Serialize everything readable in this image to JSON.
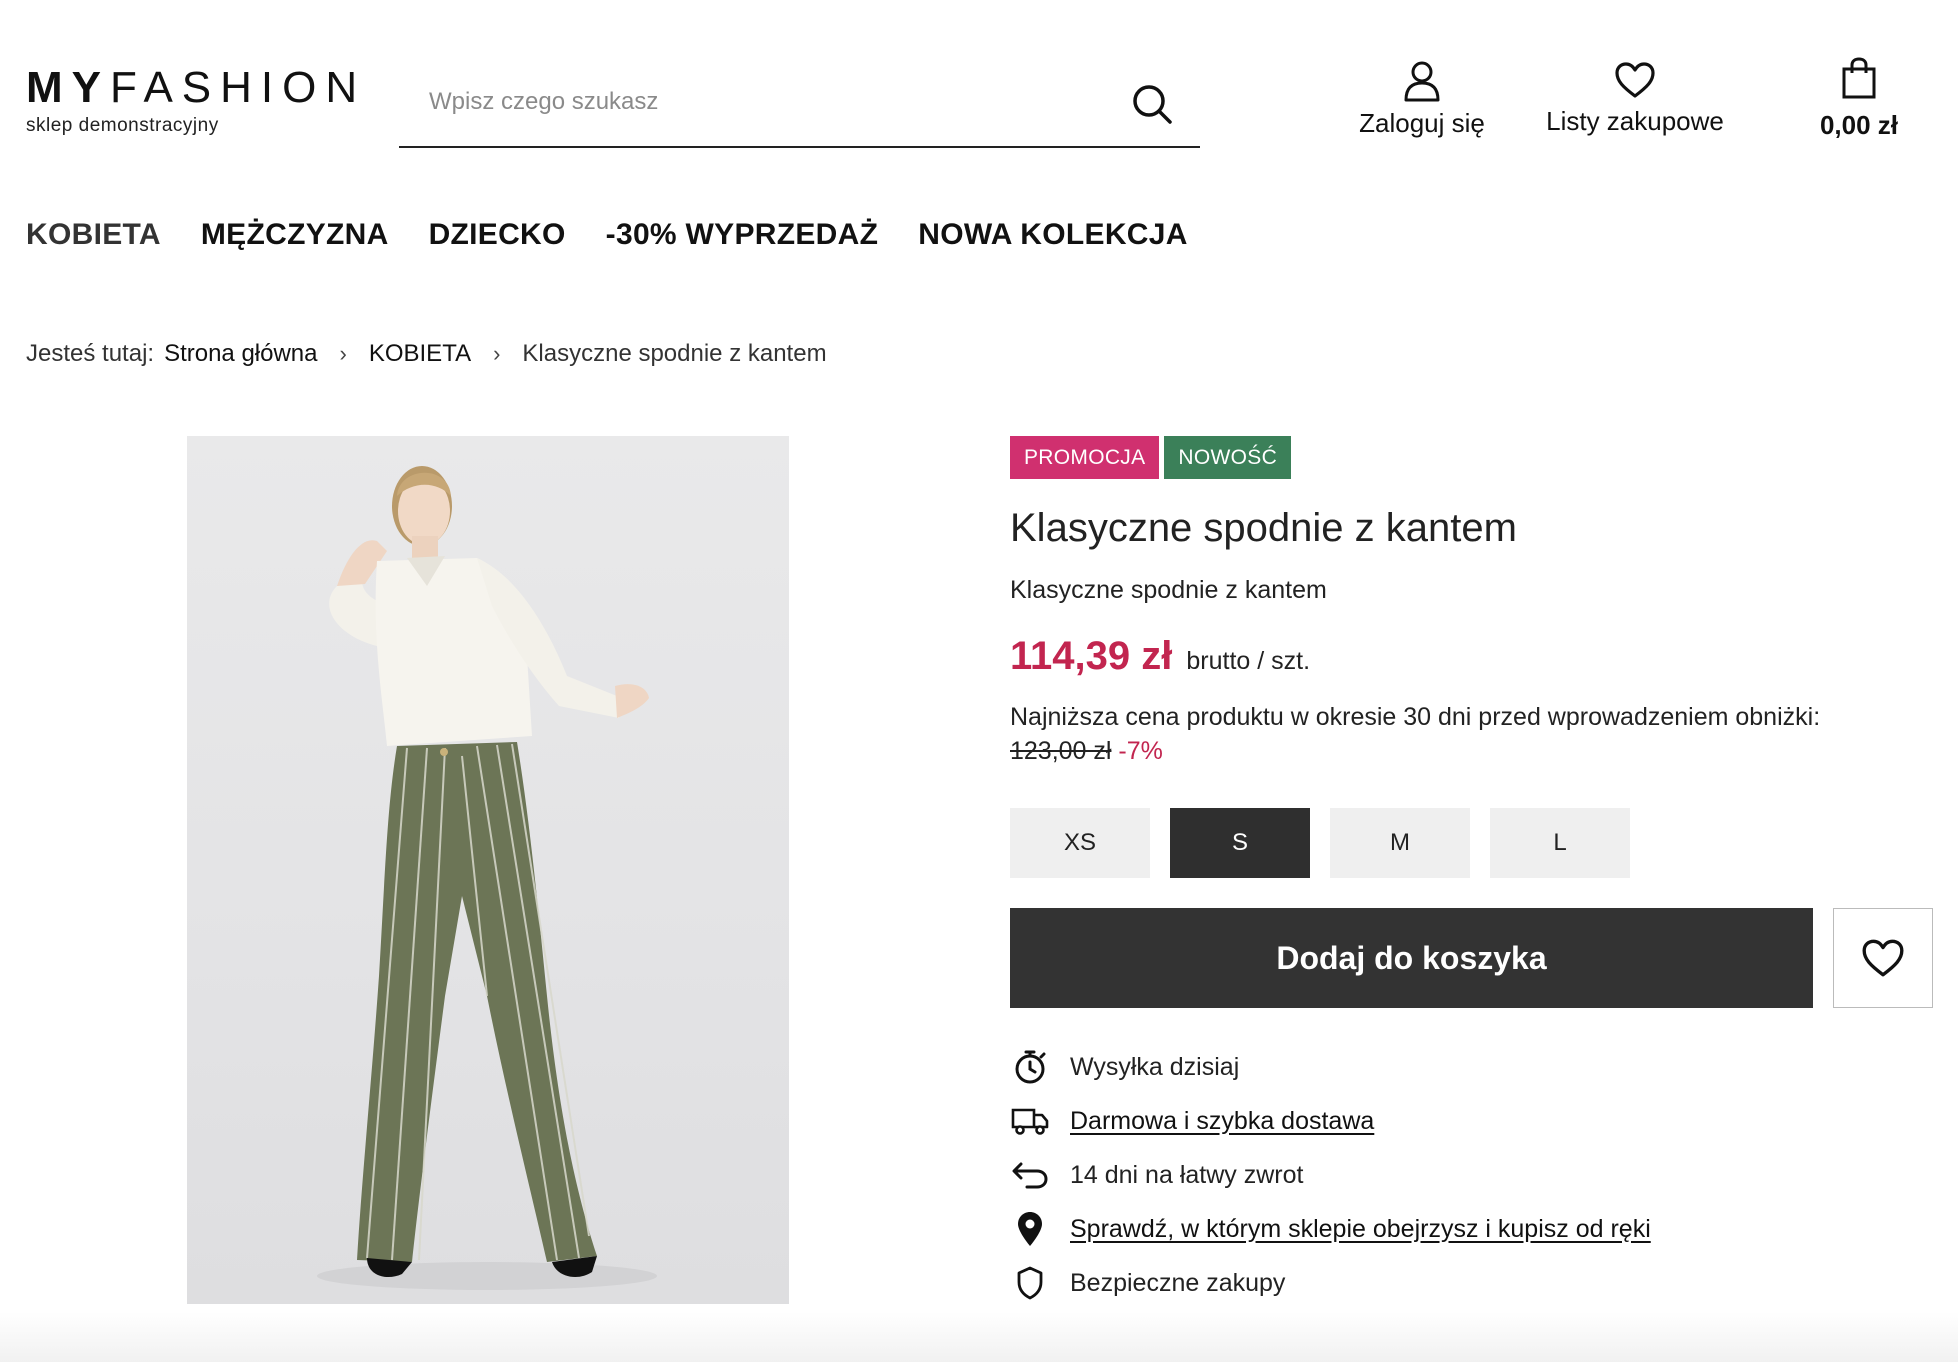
{
  "header": {
    "logo_bold": "MY",
    "logo_light": "FASHION",
    "logo_tagline": "sklep  demonstracyjny",
    "search_placeholder": "Wpisz czego szukasz",
    "search_value": "",
    "login_label": "Zaloguj się",
    "lists_label": "Listy zakupowe",
    "cart_total": "0,00 zł"
  },
  "nav": {
    "items": [
      {
        "label": "KOBIETA"
      },
      {
        "label": "MĘŻCZYZNA"
      },
      {
        "label": "DZIECKO"
      },
      {
        "label": "-30% WYPRZEDAŻ"
      },
      {
        "label": "NOWA KOLEKCJA"
      }
    ]
  },
  "breadcrumb": {
    "lead": "Jesteś tutaj:",
    "items": [
      "Strona główna",
      "KOBIETA",
      "Klasyczne spodnie z kantem"
    ]
  },
  "product": {
    "badges": [
      "PROMOCJA",
      "NOWOŚĆ"
    ],
    "title": "Klasyczne spodnie z kantem",
    "subtitle": "Klasyczne spodnie z kantem",
    "price": "114,39 zł",
    "price_unit": "brutto / szt.",
    "lowest_price_label": "Najniższa cena produktu w okresie 30 dni przed wprowadzeniem obniżki:",
    "lowest_price": "123,00 zł",
    "discount": "-7%",
    "sizes": [
      "XS",
      "S",
      "M",
      "L"
    ],
    "selected_size": "S",
    "add_to_cart_label": "Dodaj do koszyka"
  },
  "features": [
    {
      "icon": "stopwatch-icon",
      "text": "Wysyłka dzisiaj",
      "link": false
    },
    {
      "icon": "delivery-truck-icon",
      "text": "Darmowa i szybka dostawa",
      "link": true
    },
    {
      "icon": "return-arrow-icon",
      "text": "14 dni na łatwy zwrot",
      "link": false
    },
    {
      "icon": "map-pin-icon",
      "text": "Sprawdź, w którym sklepie obejrzysz i kupisz od ręki",
      "link": true
    },
    {
      "icon": "shield-icon",
      "text": "Bezpieczne zakupy",
      "link": false
    }
  ],
  "colors": {
    "price": "#c2254f",
    "badge_promo": "#d0306f",
    "badge_new": "#3b8059",
    "button_dark": "#333333"
  }
}
